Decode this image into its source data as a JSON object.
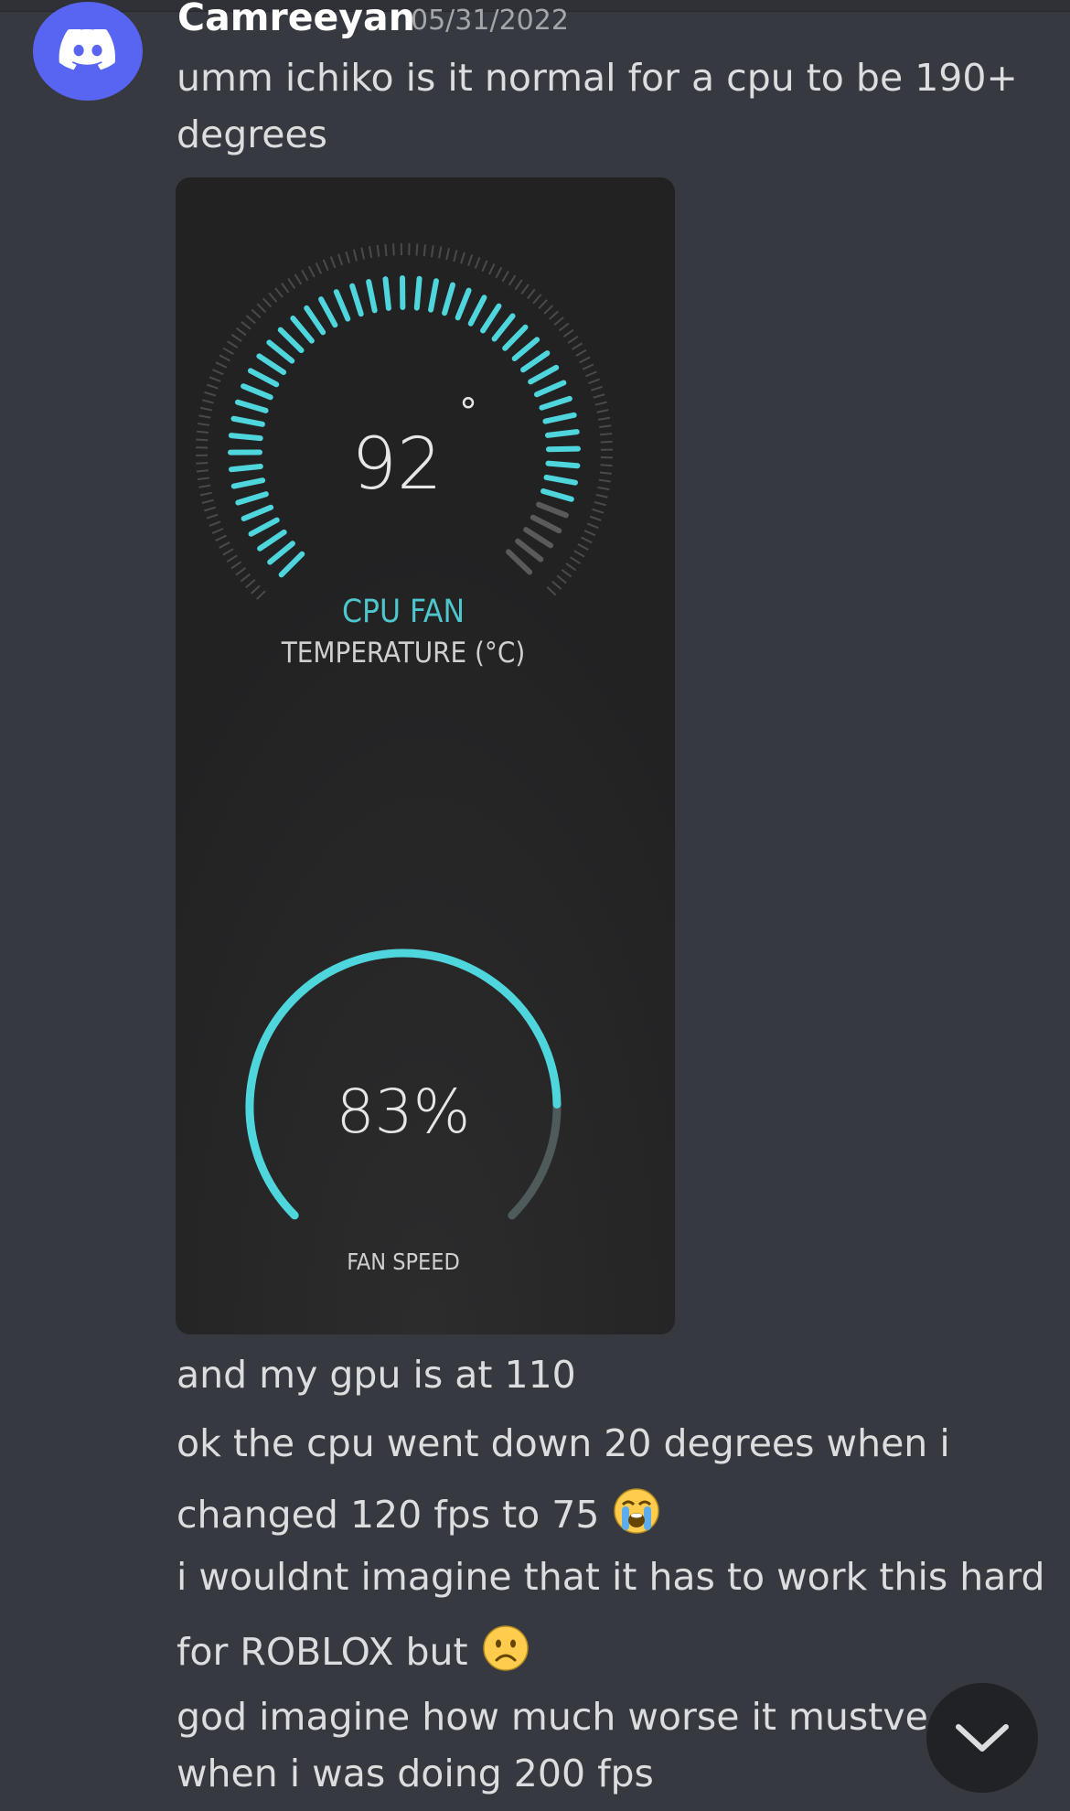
{
  "message": {
    "author": "Camreeyan",
    "timestamp": "05/31/2022",
    "lines": [
      "umm ichiko is it normal for a cpu to be 190+",
      "degrees",
      "and my gpu is at 110",
      "ok the cpu went down 20 degrees when i",
      "changed 120 fps to 75",
      "i wouldnt imagine that it has to work this hard",
      "for ROBLOX but",
      "god imagine how much worse it mustve b",
      "when i was doing 200 fps"
    ],
    "emojis": [
      "loudly-crying-face",
      "slightly-frowning-face"
    ]
  },
  "attachment": {
    "temperature_value": "92",
    "degree_symbol": "°",
    "temperature_title": "CPU FAN",
    "temperature_subtitle": "TEMPERATURE (°C)",
    "fan_speed_value": "83%",
    "fan_speed_percent": 83,
    "fan_speed_label": "FAN SPEED"
  },
  "icons": {
    "avatar": "discord-logo-icon",
    "scroll": "chevron-down-icon"
  },
  "colors": {
    "background": "#36393f",
    "avatar": "#5865f2",
    "accent": "#4fd6dd",
    "card": "#222223"
  }
}
